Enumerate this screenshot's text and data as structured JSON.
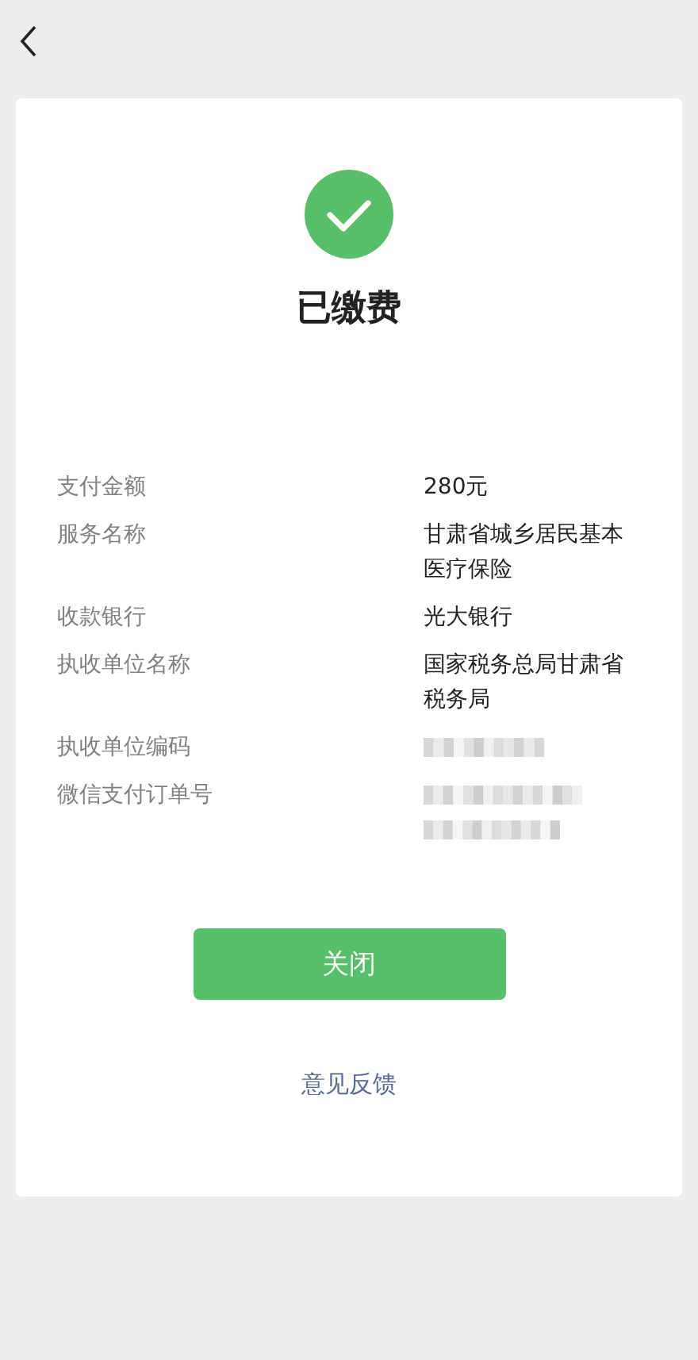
{
  "status": {
    "kind": "success",
    "title": "已缴费"
  },
  "details": [
    {
      "label": "支付金额",
      "kind": "text",
      "value": "280元"
    },
    {
      "label": "服务名称",
      "kind": "text",
      "value": "甘肃省城乡居民基本医疗保险"
    },
    {
      "label": "收款银行",
      "kind": "text",
      "value": "光大银行"
    },
    {
      "label": "执收单位名称",
      "kind": "text",
      "value": "国家税务总局甘肃省税务局"
    },
    {
      "label": "执收单位编码",
      "kind": "blurred"
    },
    {
      "label": "微信支付订单号",
      "kind": "blurredlong"
    }
  ],
  "close_button": "关闭",
  "feedback_link": "意见反馈"
}
